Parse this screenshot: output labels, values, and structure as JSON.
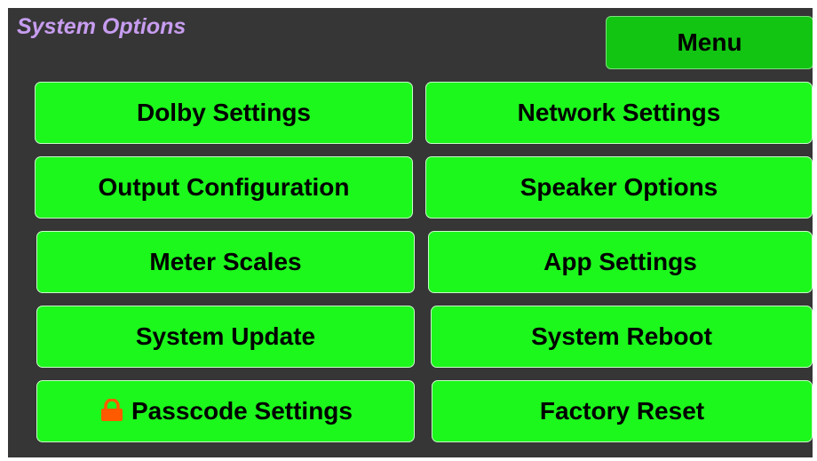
{
  "header": {
    "title": "System Options",
    "menu_label": "Menu"
  },
  "buttons": {
    "dolby": "Dolby Settings",
    "network": "Network Settings",
    "output": "Output Configuration",
    "speaker": "Speaker Options",
    "meter": "Meter Scales",
    "app": "App Settings",
    "update": "System Update",
    "reboot": "System Reboot",
    "passcode": "Passcode Settings",
    "factory": "Factory Reset"
  },
  "icons": {
    "passcode_icon": "lock-icon"
  },
  "colors": {
    "background": "#363636",
    "title": "#c79df0",
    "button": "#1cf71c",
    "menu_button": "#12c512",
    "lock": "#ff5a00"
  }
}
